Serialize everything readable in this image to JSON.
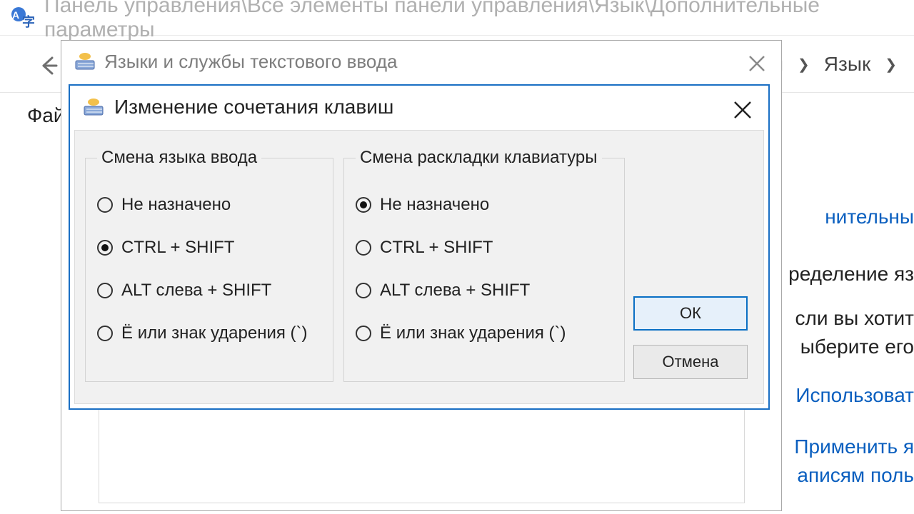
{
  "banner": {
    "path": "Панель управления\\Все элементы панели управления\\Язык\\Дополнительные параметры"
  },
  "breadcrumb": {
    "item_lang": "Язык",
    "partial_before": "я"
  },
  "menubar": {
    "file_partial": "Фай"
  },
  "right_panel": {
    "l1": "нительны",
    "l2": "ределение яз",
    "l3": "сли вы хотит",
    "l4": "ыберите его",
    "l5": "Использоват",
    "l6": "Применить я",
    "l7": "аписям поль"
  },
  "dialog1": {
    "title": "Языки и службы текстового ввода"
  },
  "dialog2": {
    "title": "Изменение сочетания клавиш",
    "group1": {
      "legend": "Смена языка ввода",
      "options": [
        "Не назначено",
        "CTRL + SHIFT",
        "ALT слева + SHIFT",
        "Ё или знак ударения (`)"
      ],
      "checked_index": 1
    },
    "group2": {
      "legend": "Смена раскладки клавиатуры",
      "options": [
        "Не назначено",
        "CTRL + SHIFT",
        "ALT слева + SHIFT",
        "Ё или знак ударения (`)"
      ],
      "checked_index": 0
    },
    "ok": "ОК",
    "cancel": "Отмена"
  }
}
